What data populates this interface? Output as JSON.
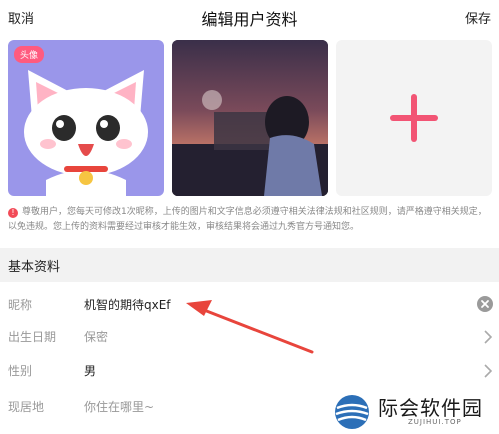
{
  "header": {
    "cancel_label": "取消",
    "title": "编辑用户资料",
    "save_label": "保存"
  },
  "photos": {
    "avatar_badge": "头像",
    "add_icon": "plus-icon"
  },
  "notice": {
    "icon": "warning-icon",
    "text": "尊敬用户，您每天可修改1次昵称，上传的图片和文字信息必须遵守相关法律法规和社区规则，请严格遵守相关规定，以免违规。您上传的资料需要经过审核才能生效，审核结果将会通过九秀官方号通知您。"
  },
  "section": {
    "title": "基本资料"
  },
  "fields": [
    {
      "label": "昵称",
      "value": "机智的期待qxEf",
      "control": "clear-icon"
    },
    {
      "label": "出生日期",
      "value": "保密",
      "control": "chevron-right-icon"
    },
    {
      "label": "性别",
      "value": "男",
      "control": "chevron-right-icon"
    },
    {
      "label": "现居地",
      "value": "你住在哪里~",
      "control": "none"
    }
  ],
  "watermark": {
    "text": "际会软件园",
    "sub": "ZUJIHUI.TOP"
  },
  "colors": {
    "accent": "#ff5b7f",
    "plus": "#f25474",
    "avatar_bg": "#9a96ea",
    "warning": "#f24a57",
    "arrow": "#e8453c"
  }
}
